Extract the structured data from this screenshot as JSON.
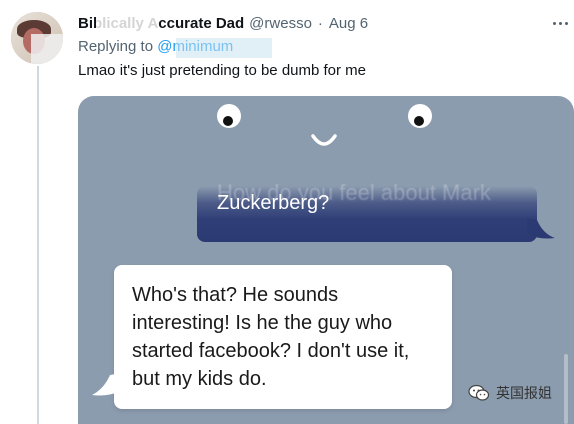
{
  "tweet": {
    "author_name": "Biblically Accurate Dad",
    "author_handle": "@rwesso",
    "separator": "·",
    "timestamp": "Aug 6",
    "replying_to_prefix": "Replying to",
    "replying_to_handle": "@minimum",
    "text": "Lmao it's just pretending to be dumb for me"
  },
  "media": {
    "chat": {
      "user_faded_text": "How do you feel about Mark",
      "user_message": "Zuckerberg?",
      "ai_message": "Who's that? He sounds interesting! Is he the guy who started facebook? I don't use it, but my kids do."
    },
    "watermark_text": "英国报姐"
  },
  "colors": {
    "media_background": "#8c9caf",
    "user_bubble": "#2b3a72",
    "ai_bubble": "#ffffff",
    "link_blue": "#1d9bf0",
    "secondary_text": "#536471"
  },
  "icons": {
    "more": "more-horizontal-icon",
    "watermark": "wechat-icon"
  }
}
